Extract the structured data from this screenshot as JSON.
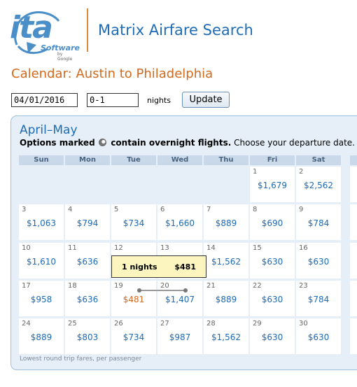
{
  "header": {
    "logo_text": "ita",
    "logo_sub": "Software",
    "logo_by": "by Google",
    "app_title": "Matrix Airfare Search"
  },
  "page_title": "Calendar: Austin to Philadelphia",
  "controls": {
    "date_value": "04/01/2016",
    "nights_value": "0-1",
    "nights_label": "nights",
    "update_label": "Update"
  },
  "calendar": {
    "title": "April–May",
    "options_bold": "Options marked",
    "options_bold2": "contain overnight flights.",
    "options_rest": "Choose your departure date.",
    "weekdays": [
      "Sun",
      "Mon",
      "Tue",
      "Wed",
      "Thu",
      "Fri",
      "Sat"
    ],
    "weeks": [
      [
        null,
        null,
        null,
        null,
        null,
        {
          "day": "1",
          "price": "$1,679"
        },
        {
          "day": "2",
          "price": "$2,562"
        }
      ],
      [
        {
          "day": "3",
          "price": "$1,063"
        },
        {
          "day": "4",
          "price": "$794"
        },
        {
          "day": "5",
          "price": "$734"
        },
        {
          "day": "6",
          "price": "$1,660"
        },
        {
          "day": "7",
          "price": "$889"
        },
        {
          "day": "8",
          "price": "$690"
        },
        {
          "day": "9",
          "price": "$784"
        }
      ],
      [
        {
          "day": "10",
          "price": "$1,610"
        },
        {
          "day": "11",
          "price": "$636"
        },
        {
          "day": "12",
          "price": ""
        },
        {
          "day": "13",
          "price": ""
        },
        {
          "day": "14",
          "price": "$1,562"
        },
        {
          "day": "15",
          "price": "$630"
        },
        {
          "day": "16",
          "price": "$630"
        }
      ],
      [
        {
          "day": "17",
          "price": "$958"
        },
        {
          "day": "18",
          "price": "$636"
        },
        {
          "day": "19",
          "price": "$481",
          "selected": true
        },
        {
          "day": "20",
          "price": "$1,407"
        },
        {
          "day": "21",
          "price": "$889"
        },
        {
          "day": "22",
          "price": "$630"
        },
        {
          "day": "23",
          "price": "$784"
        }
      ],
      [
        {
          "day": "24",
          "price": "$889"
        },
        {
          "day": "25",
          "price": "$803"
        },
        {
          "day": "26",
          "price": "$734"
        },
        {
          "day": "27",
          "price": "$987"
        },
        {
          "day": "28",
          "price": "$1,562"
        },
        {
          "day": "29",
          "price": "$630"
        },
        {
          "day": "30",
          "price": "$630"
        }
      ]
    ],
    "tooltip": {
      "nights": "1 nights",
      "price": "$481"
    },
    "footnote": "Lowest round trip fares, per passenger"
  },
  "colors": {
    "accent_blue": "#1f6bb4",
    "accent_orange": "#d2691e",
    "panel_bg": "#e6eff8",
    "tooltip_bg": "#fdf5c0"
  }
}
